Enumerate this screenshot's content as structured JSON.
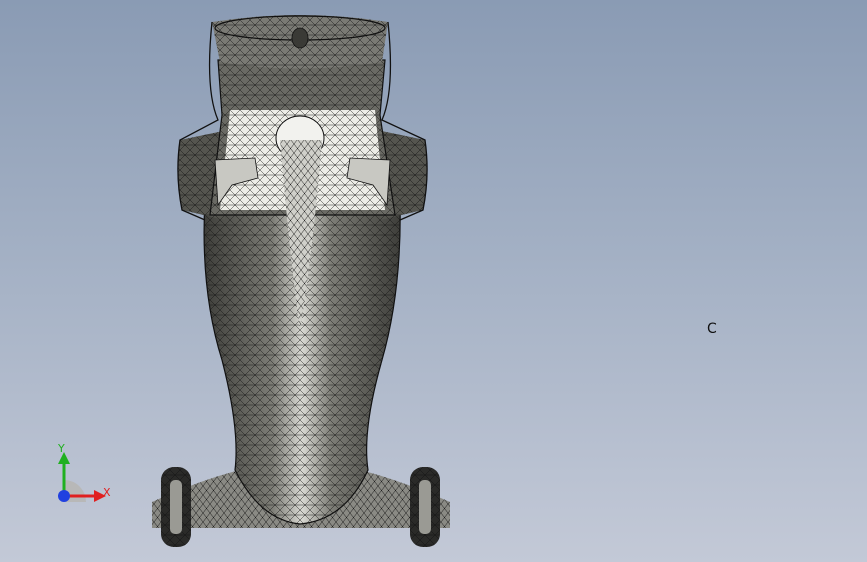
{
  "viewport": {
    "view_label": "C",
    "mode": "wireframe",
    "background_colors": [
      "#8a9bb4",
      "#c3c9d7"
    ]
  },
  "triad": {
    "x_label": "X",
    "y_label": "Y",
    "x_color": "#e02020",
    "y_color": "#20b020",
    "z_color": "#2040e0"
  },
  "model": {
    "shell_color": "#5c5c58",
    "highlight_color": "#f2f2ee",
    "wire_color": "#111111"
  }
}
